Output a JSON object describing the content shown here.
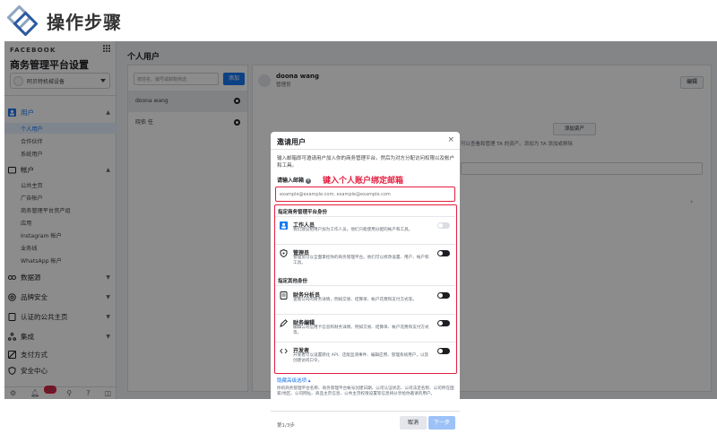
{
  "banner": {
    "title": "操作步骤"
  },
  "sidebar": {
    "brand": "FACEBOOK",
    "title": "商务管理平台设置",
    "account": "阿贝特机械设备",
    "sections": [
      {
        "label": "用户",
        "active": true,
        "items": [
          "个人用户",
          "合作伙伴",
          "系统用户"
        ]
      },
      {
        "label": "帐户",
        "active": false,
        "items": [
          "公共主页",
          "广告帐户",
          "商务管理平台资产组",
          "应用",
          "Instagram 帐户",
          "业务线",
          "WhatsApp 帐户"
        ]
      },
      {
        "label": "数据源"
      },
      {
        "label": "品牌安全"
      },
      {
        "label": "认证的公共主页"
      },
      {
        "label": "集成"
      },
      {
        "label": "支付方式"
      },
      {
        "label": "安全中心"
      }
    ],
    "notification_count": "22"
  },
  "main": {
    "title": "个人用户",
    "search_placeholder": "按姓名、编号或邮箱筛选",
    "add_label": "添加",
    "people": [
      "doona wang",
      "晓依 任"
    ],
    "detail": {
      "name": "doona wang",
      "role": "管理员",
      "meta": "已邀请 · 输入商务管理平台已1月1日",
      "edit_label": "编辑",
      "assign_label": "添加资产",
      "desc": "可以查看和管理 TA 的资产。添加为 TA 添加或移除"
    }
  },
  "modal": {
    "title": "邀请用户",
    "intro": "输入邮箱即可邀请用户加入你的商务管理平台。然后为对方分配访问权限以及帐户和工具。",
    "email_label": "请输入邮箱",
    "email_placeholder": "example@example.com, example@example.com",
    "annotation": "键入个人账户绑定邮箱",
    "group1_title": "指定商务管理平台身份",
    "group1_roles": [
      {
        "name": "工作人员",
        "desc": "我们建议把用户加为工作人员。他们只能使用分配的帐户和工具。",
        "toggle": "disabled",
        "icon": "people-icon"
      },
      {
        "name": "管理员",
        "desc": "管理员可以全面掌控你的商务管理平台。他们可以修改设置、用户、帐户和工具。",
        "toggle": "dark",
        "icon": "shield-icon"
      }
    ],
    "group2_title": "指定其他身份",
    "group2_roles": [
      {
        "name": "财务分析员",
        "desc": "查看公司的财务详情，例如交易、结算单、帐户花费和支付方式等。",
        "toggle": "dark",
        "icon": "doc-icon"
      },
      {
        "name": "财务编辑",
        "desc": "编辑公司信用卡信息和财务详情，例如交易、结算单、帐户花费和支付方式等。",
        "toggle": "dark",
        "icon": "pencil-icon"
      },
      {
        "name": "开发者",
        "desc": "开发者可以设置转化 API、还能监测事件、编辑应用、管理系统用户，以及创建访问口令。",
        "toggle": "dark",
        "icon": "code-icon"
      }
    ],
    "advanced_label": "隐藏高级选项 ▴",
    "footnote": "你的商务管理平台名称、商务管理平台帐号创建日期、公司认证状态、公司法定名称、公司所在国家/地区、公司网址、商品主页信息、公共主页权限设置等信息将分享给你邀请的用户。",
    "step": "第1/3步",
    "cancel_label": "取消",
    "next_label": "下一步"
  }
}
